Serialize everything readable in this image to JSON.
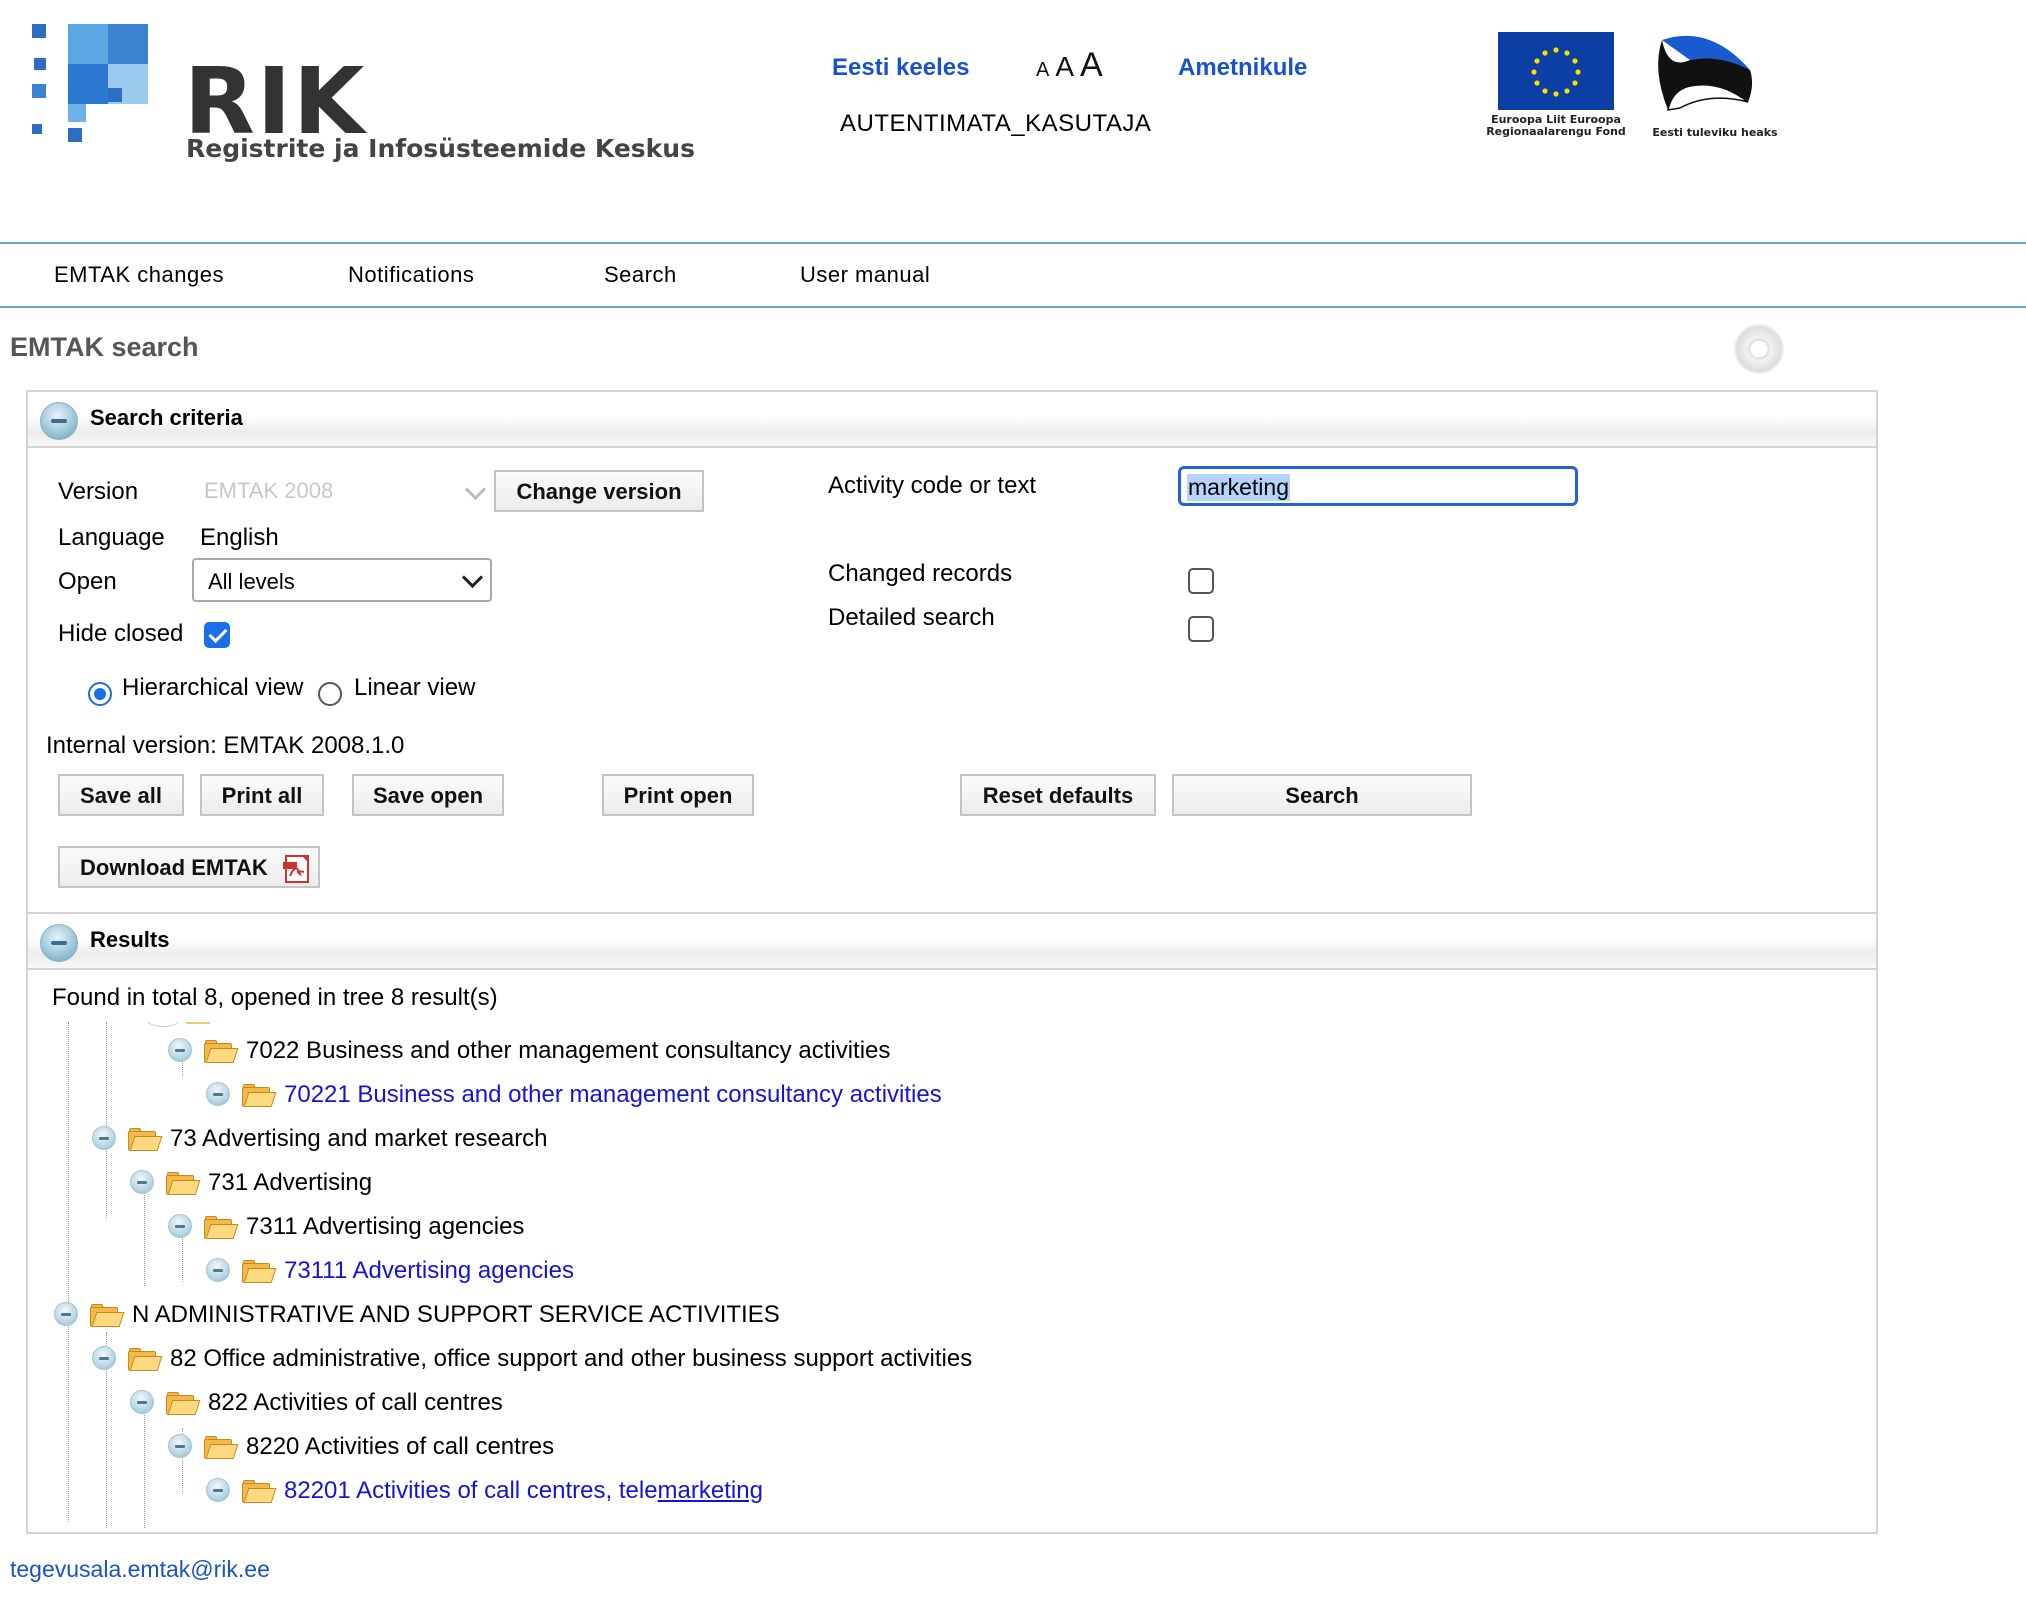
{
  "header": {
    "logo_word": "RIK",
    "logo_subtitle": "Registrite ja Infosüsteemide Keskus",
    "lang_link": "Eesti keeles",
    "font_sizes": [
      "A",
      "A",
      "A"
    ],
    "officials_link": "Ametnikule",
    "user": "AUTENTIMATA_KASUTAJA",
    "eu_caption": "Euroopa Liit Euroopa Regionaalarengu Fond",
    "ee_caption": "Eesti tuleviku heaks"
  },
  "nav": [
    "EMTAK changes",
    "Notifications",
    "Search",
    "User manual"
  ],
  "page_title": "EMTAK search",
  "criteria": {
    "title": "Search criteria",
    "version_label": "Version",
    "version_value": "EMTAK 2008",
    "change_version": "Change version",
    "language_label": "Language",
    "language_value": "English",
    "open_label": "Open",
    "open_value": "All levels",
    "hide_closed_label": "Hide closed",
    "hide_closed": true,
    "hierarchical_label": "Hierarchical view",
    "linear_label": "Linear view",
    "view": "hierarchical",
    "activity_label": "Activity code or text",
    "activity_value": "marketing",
    "changed_label": "Changed records",
    "changed": false,
    "detailed_label": "Detailed search",
    "detailed": false,
    "internal_version": "Internal version: EMTAK 2008.1.0",
    "buttons": {
      "save_all": "Save all",
      "print_all": "Print all",
      "save_open": "Save open",
      "print_open": "Print open",
      "reset": "Reset defaults",
      "search": "Search",
      "download": "Download EMTAK"
    }
  },
  "results": {
    "title": "Results",
    "summary": "Found in total 8, opened in tree 8 result(s)",
    "nodes": [
      {
        "text": "7022 Business and other management consultancy activities",
        "level": 3,
        "leaf": false
      },
      {
        "text": "70221 Business and other management consultancy activities",
        "level": 4,
        "leaf": true
      },
      {
        "text": "73 Advertising and market research",
        "level": 1,
        "leaf": false
      },
      {
        "text": "731 Advertising",
        "level": 2,
        "leaf": false
      },
      {
        "text": "7311 Advertising agencies",
        "level": 3,
        "leaf": false
      },
      {
        "text": "73111 Advertising agencies",
        "level": 4,
        "leaf": true
      },
      {
        "text": "N ADMINISTRATIVE AND SUPPORT SERVICE ACTIVITIES",
        "level": 0,
        "leaf": false
      },
      {
        "text": "82 Office administrative, office support and other business support activities",
        "level": 1,
        "leaf": false
      },
      {
        "text": "822 Activities of call centres",
        "level": 2,
        "leaf": false
      },
      {
        "text": "8220 Activities of call centres",
        "level": 3,
        "leaf": false
      },
      {
        "text": "82201 Activities of call centres, tele",
        "suffix": "marketing",
        "level": 4,
        "leaf": true
      }
    ]
  },
  "footer_email": "tegevusala.emtak@rik.ee",
  "colors": {
    "link": "#1a52c9",
    "leaf": "#1414d6",
    "nav_border": "#6ea3d2",
    "accent": "#1a6fe8"
  }
}
